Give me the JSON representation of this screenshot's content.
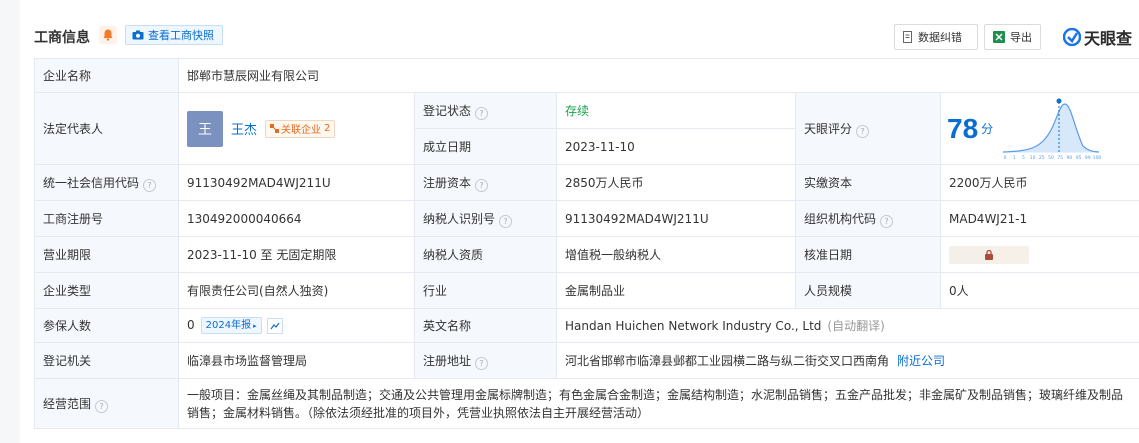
{
  "header": {
    "title": "工商信息",
    "snapshot_btn": "查看工商快照",
    "correct_btn": "数据纠错",
    "export_btn": "导出",
    "logo": "天眼查"
  },
  "rows": {
    "company_name_label": "企业名称",
    "company_name": "邯郸市慧辰网业有限公司",
    "legal_rep_label": "法定代表人",
    "avatar_char": "王",
    "legal_rep_name": "王杰",
    "related_label": "关联企业",
    "related_count": "2",
    "reg_status_label": "登记状态",
    "reg_status": "存续",
    "found_date_label": "成立日期",
    "found_date": "2023-11-10",
    "score_label": "天眼评分",
    "score": "78",
    "score_unit": "分",
    "credit_code_label": "统一社会信用代码",
    "credit_code": "91130492MAD4WJ211U",
    "reg_capital_label": "注册资本",
    "reg_capital": "2850万人民币",
    "paid_capital_label": "实缴资本",
    "paid_capital": "2200万人民币",
    "reg_no_label": "工商注册号",
    "reg_no": "130492000040664",
    "taxpayer_id_label": "纳税人识别号",
    "taxpayer_id": "91130492MAD4WJ211U",
    "org_code_label": "组织机构代码",
    "org_code": "MAD4WJ21-1",
    "term_label": "营业期限",
    "term": "2023-11-10 至 无固定期限",
    "taxpayer_qual_label": "纳税人资质",
    "taxpayer_qual": "增值税一般纳税人",
    "approve_date_label": "核准日期",
    "type_label": "企业类型",
    "type": "有限责任公司(自然人独资)",
    "industry_label": "行业",
    "industry": "金属制品业",
    "staff_label": "人员规模",
    "staff": "0人",
    "insured_label": "参保人数",
    "insured": "0",
    "insured_year": "2024年报",
    "en_name_label": "英文名称",
    "en_name": "Handan Huichen Network Industry Co., Ltd",
    "auto_translate": "(自动翻译)",
    "authority_label": "登记机关",
    "authority": "临漳县市场监督管理局",
    "address_label": "注册地址",
    "address": "河北省邯郸市临漳县邺都工业园横二路与纵二街交叉口西南角",
    "nearby": "附近公司",
    "scope_label": "经营范围",
    "scope": "一般项目：金属丝绳及其制品制造；交通及公共管理用金属标牌制造；有色金属合金制造；金属结构制造；水泥制品销售；五金产品批发；非金属矿及制品销售；玻璃纤维及制品销售；金属材料销售。（除依法须经批准的项目外，凭营业执照依法自主开展经营活动）"
  },
  "score_chart": {
    "x_ticks": [
      "0",
      "1",
      "5",
      "10",
      "25",
      "50",
      "75",
      "90",
      "95",
      "99",
      "100"
    ]
  },
  "colors": {
    "accent": "#0a6ed1",
    "status_green": "#17a34a",
    "label_bg": "#f5f8fc"
  }
}
